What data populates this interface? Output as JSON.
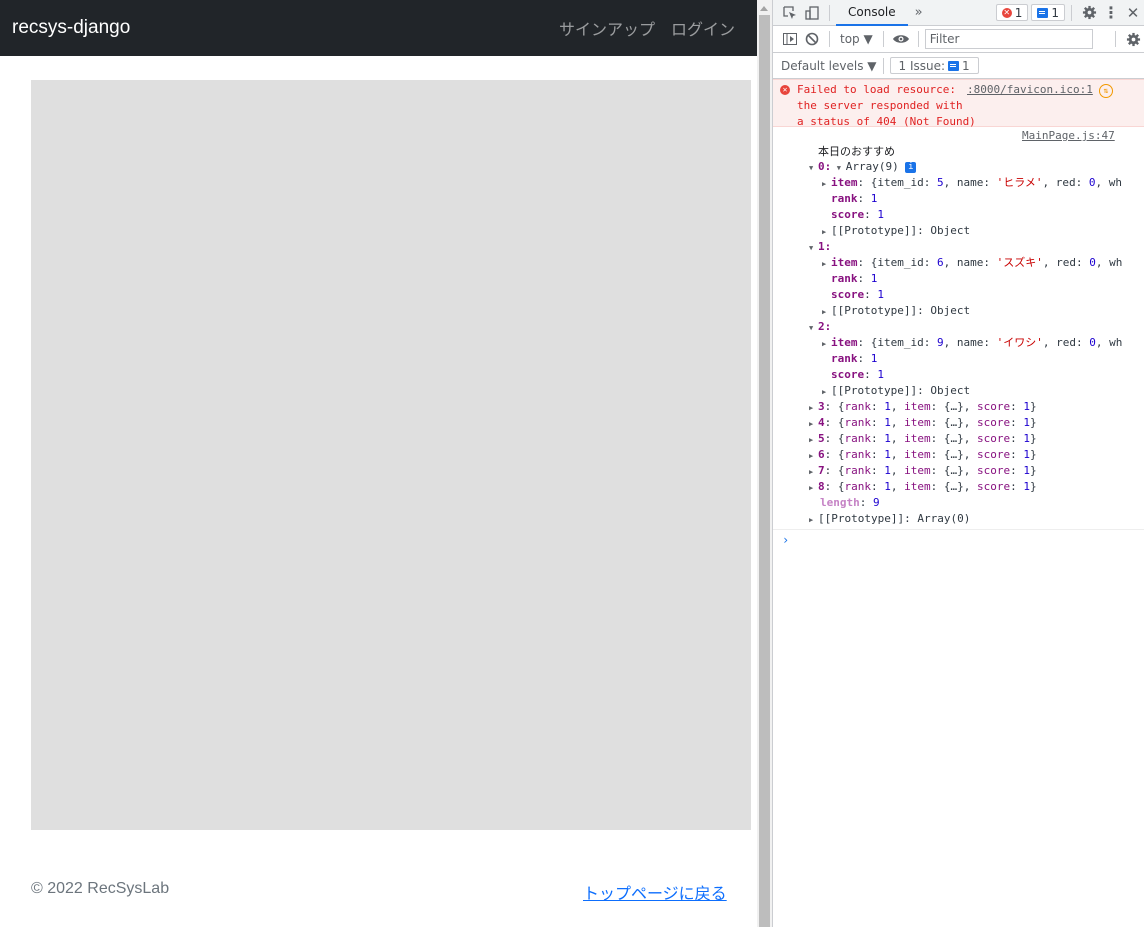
{
  "page": {
    "brand": "recsys-django",
    "nav": [
      {
        "label": "サインアップ"
      },
      {
        "label": "ログイン"
      }
    ],
    "footer": {
      "copyright": "© 2022 RecSysLab",
      "back_link": "トップページに戻る"
    }
  },
  "devtools": {
    "tabs": {
      "active": "Console",
      "more": "»",
      "error_count": "1",
      "message_count": "1"
    },
    "toolbar": {
      "context": "top ▼",
      "filter_placeholder": "Filter"
    },
    "levels": {
      "label": "Default levels ▼",
      "issues_label": "1 Issue:",
      "issues_count": "1"
    },
    "error": {
      "text": "Failed to load resource:\nthe server responded with\na status of 404 (Not Found)",
      "source": ":8000/favicon.ico:1"
    },
    "log": {
      "label": "本日のおすすめ",
      "source": "MainPage.js:47",
      "array_label": "Array(9)",
      "expanded": [
        {
          "index": "0",
          "item_preview": "{item_id: 5, name: 'ヒラメ', red: 0, wh",
          "item_id": "5",
          "name": "'ヒラメ'",
          "rank": "1",
          "score": "1",
          "proto": "Object"
        },
        {
          "index": "1",
          "item_preview": "{item_id: 6, name: 'スズキ', red: 0, wh",
          "item_id": "6",
          "name": "'スズキ'",
          "rank": "1",
          "score": "1",
          "proto": "Object"
        },
        {
          "index": "2",
          "item_preview": "{item_id: 9, name: 'イワシ', red: 0, wh",
          "item_id": "9",
          "name": "'イワシ'",
          "rank": "1",
          "score": "1",
          "proto": "Object"
        }
      ],
      "collapsed": [
        {
          "index": "3",
          "rank": "1",
          "score": "1"
        },
        {
          "index": "4",
          "rank": "1",
          "score": "1"
        },
        {
          "index": "5",
          "rank": "1",
          "score": "1"
        },
        {
          "index": "6",
          "rank": "1",
          "score": "1"
        },
        {
          "index": "7",
          "rank": "1",
          "score": "1"
        },
        {
          "index": "8",
          "rank": "1",
          "score": "1"
        }
      ],
      "length": "9",
      "array_proto": "Array(0)"
    },
    "prompt": "›"
  }
}
